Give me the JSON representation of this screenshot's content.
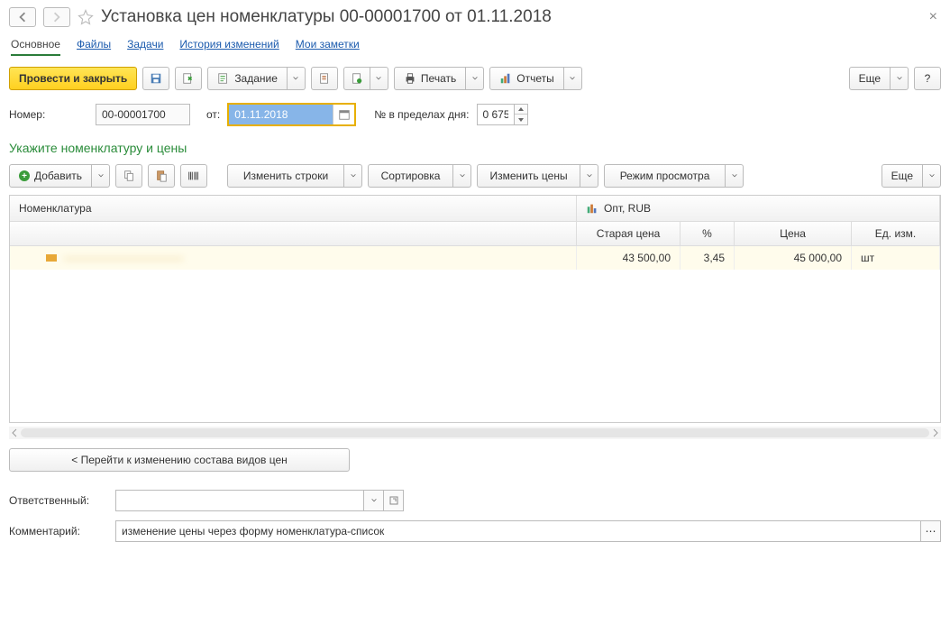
{
  "header": {
    "title": "Установка цен номенклатуры 00-00001700 от 01.11.2018"
  },
  "tabs": {
    "main": "Основное",
    "files": "Файлы",
    "tasks": "Задачи",
    "history": "История изменений",
    "notes": "Мои заметки"
  },
  "toolbar": {
    "post_close": "Провести и закрыть",
    "task": "Задание",
    "print": "Печать",
    "reports": "Отчеты",
    "more": "Еще",
    "help": "?"
  },
  "form": {
    "number_lbl": "Номер:",
    "number": "00-00001700",
    "from_lbl": "от:",
    "date": "01.11.2018",
    "day_num_lbl": "№ в пределах дня:",
    "day_num": "0 675"
  },
  "section": {
    "title": "Укажите номенклатуру и цены"
  },
  "tbl_toolbar": {
    "add": "Добавить",
    "change_rows": "Изменить строки",
    "sort": "Сортировка",
    "change_prices": "Изменить цены",
    "view_mode": "Режим просмотра",
    "more": "Еще"
  },
  "grid": {
    "col_item": "Номенклатура",
    "col_opt": "Опт, RUB",
    "col_old": "Старая цена",
    "col_pct": "%",
    "col_price": "Цена",
    "col_unit": "Ед. изм.",
    "rows": [
      {
        "item": "———————————",
        "old": "43 500,00",
        "pct": "3,45",
        "price": "45 000,00",
        "unit": "шт"
      }
    ]
  },
  "link_btn": "< Перейти к изменению состава видов цен",
  "fields": {
    "resp_lbl": "Ответственный:",
    "resp": "",
    "comment_lbl": "Комментарий:",
    "comment": "изменение цены через форму номенклатура-список"
  }
}
